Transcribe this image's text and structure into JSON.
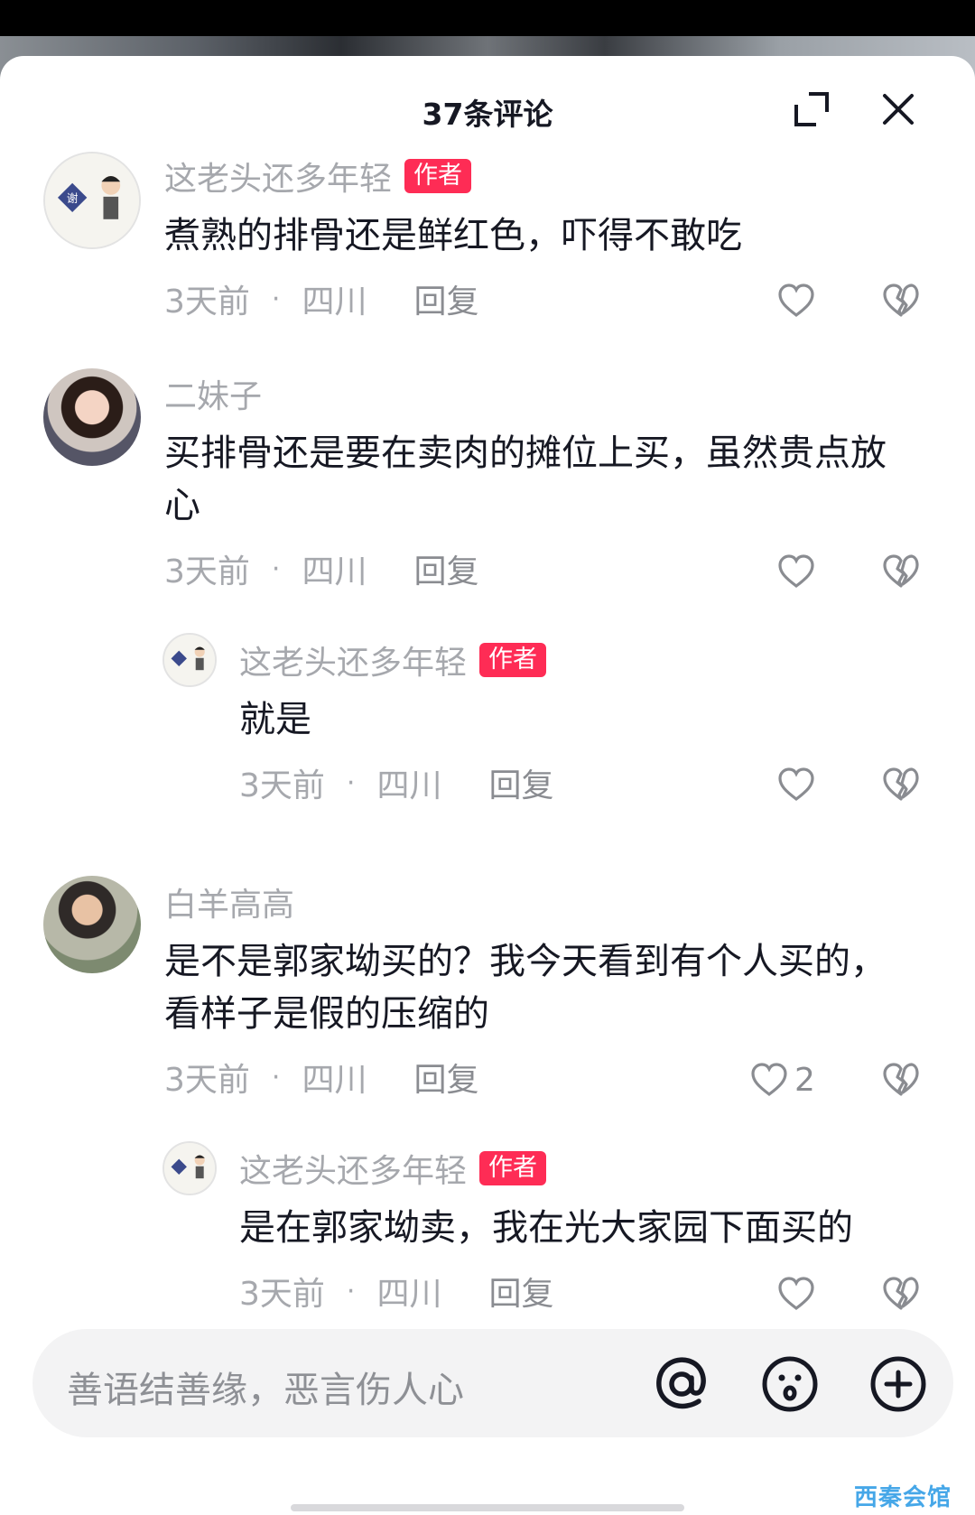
{
  "header": {
    "title": "37条评论"
  },
  "icons": {
    "expand": "expand-icon",
    "close": "close-icon",
    "like": "heart-icon",
    "dislike": "broken-heart-icon",
    "at": "at-icon",
    "emoji": "emoji-icon",
    "add": "plus-circle-icon"
  },
  "colors": {
    "badge": "#fe2c55",
    "meta_text": "#a6a8ad",
    "main_text": "#161823"
  },
  "comments": [
    {
      "name": "这老头还多年轻",
      "badge": "作者",
      "text": "煮熟的排骨还是鲜红色，吓得不敢吃",
      "time": "3天前",
      "dot": "·",
      "location": "四川",
      "reply": "回复"
    },
    {
      "name": "二妹子",
      "text": "买排骨还是要在卖肉的摊位上买，虽然贵点放心",
      "time": "3天前",
      "dot": "·",
      "location": "四川",
      "reply": "回复",
      "replies": [
        {
          "name": "这老头还多年轻",
          "badge": "作者",
          "text": "就是",
          "time": "3天前",
          "dot": "·",
          "location": "四川",
          "reply": "回复"
        }
      ]
    },
    {
      "name": "白羊高高",
      "text": "是不是郭家坳买的？我今天看到有个人买的，看样子是假的压缩的",
      "time": "3天前",
      "dot": "·",
      "location": "四川",
      "reply": "回复",
      "likes": "2",
      "replies": [
        {
          "name": "这老头还多年轻",
          "badge": "作者",
          "text": "是在郭家坳卖，我在光大家园下面买的",
          "time": "3天前",
          "dot": "·",
          "location": "四川",
          "reply": "回复"
        }
      ]
    }
  ],
  "composer": {
    "placeholder": "善语结善缘，恶言伤人心"
  },
  "watermark": "西秦会馆"
}
